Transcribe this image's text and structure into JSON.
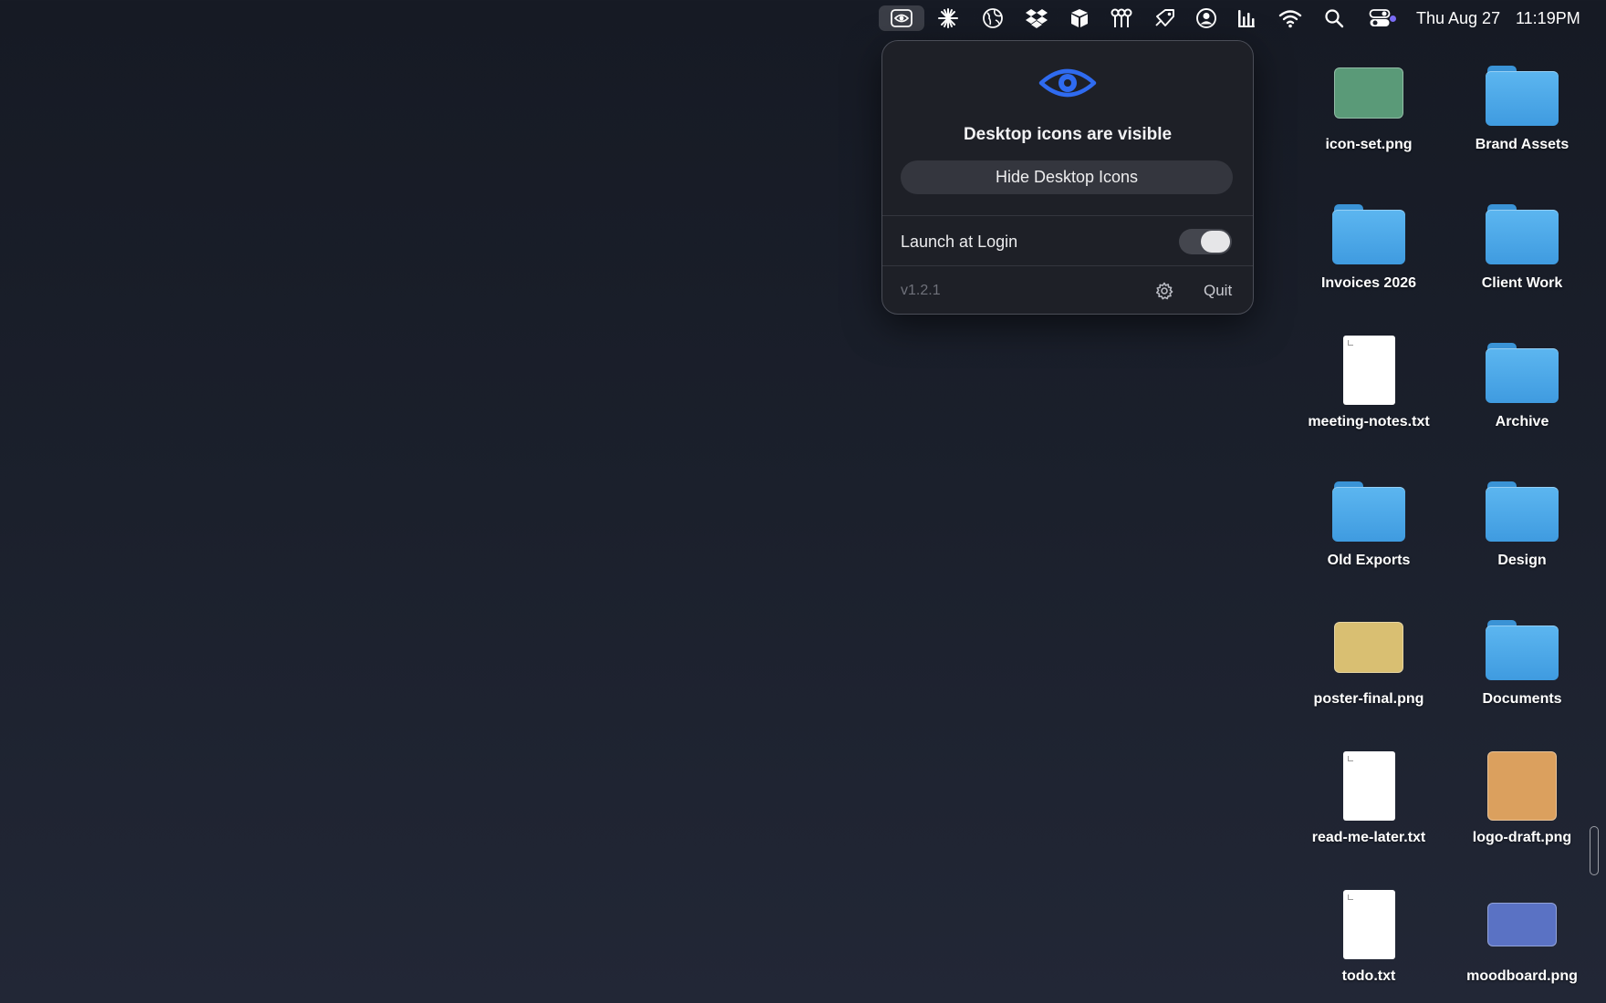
{
  "menubar": {
    "icons": [
      "eye-toggle-icon",
      "sparkle-icon",
      "globe-icon",
      "dropbox-icon",
      "box-icon",
      "keys-icon",
      "tag-icon",
      "user-circle-icon",
      "audio-bars-icon",
      "wifi-icon",
      "search-icon",
      "control-center-icon"
    ],
    "date": "Thu Aug 27",
    "time": "11:19PM",
    "accent_dot_color": "#7a6cf5"
  },
  "popover": {
    "status": "Desktop icons are visible",
    "hide_button": "Hide Desktop Icons",
    "launch_label": "Launch at Login",
    "launch_at_login": true,
    "version": "v1.2.1",
    "quit_label": "Quit",
    "eye_color": "#2f6bf0"
  },
  "desktop": {
    "items": [
      {
        "label": "icon-set.png",
        "kind": "image",
        "color": "#5a9a78"
      },
      {
        "label": "Brand Assets",
        "kind": "folder"
      },
      {
        "label": "Invoices 2026",
        "kind": "folder"
      },
      {
        "label": "Client Work",
        "kind": "folder"
      },
      {
        "label": "meeting-notes.txt",
        "kind": "text"
      },
      {
        "label": "Archive",
        "kind": "folder"
      },
      {
        "label": "Old Exports",
        "kind": "folder"
      },
      {
        "label": "Design",
        "kind": "folder"
      },
      {
        "label": "poster-final.png",
        "kind": "image",
        "color": "#d9bf72"
      },
      {
        "label": "Documents",
        "kind": "folder"
      },
      {
        "label": "read-me-later.txt",
        "kind": "text"
      },
      {
        "label": "logo-draft.png",
        "kind": "image",
        "color": "#dba05e"
      },
      {
        "label": "todo.txt",
        "kind": "text"
      },
      {
        "label": "moodboard.png",
        "kind": "image",
        "color": "#5a72c4"
      }
    ]
  }
}
